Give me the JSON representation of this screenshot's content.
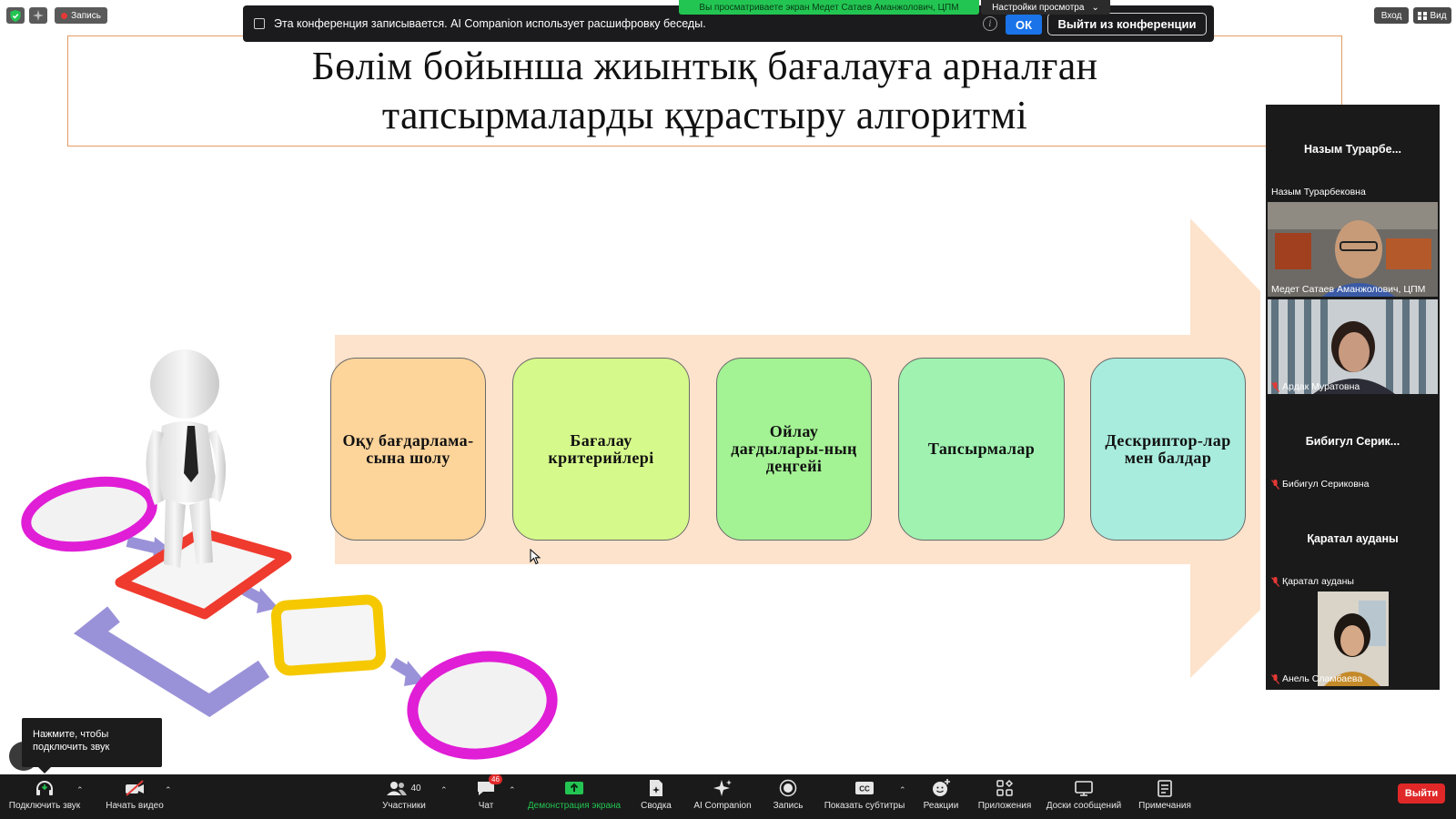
{
  "top_left": {
    "record_label": "Запись"
  },
  "top_right": {
    "login_label": "Вход",
    "view_label": "Вид"
  },
  "banner": {
    "text": "Эта конференция записывается. AI Companion использует расшифровку беседы.",
    "info": "i",
    "ok_label": "ОК",
    "leave_label": "Выйти из конференции",
    "viewing_text": "Вы просматриваете экран Медет Сатаев Аманжолович, ЦПМ",
    "view_settings": "Настройки просмотра"
  },
  "slide": {
    "title_line1": "Бөлім бойынша жиынтық бағалауға арналған",
    "title_line2": "тапсырмаларды құрастыру алгоритмі",
    "steps": [
      {
        "text": "Оқу бағдарлама-сына шолу",
        "color": "#fdd49a"
      },
      {
        "text": "Бағалау критерийлері",
        "color": "#d6f98b"
      },
      {
        "text": "Ойлау дағдылары-ның деңгейі",
        "color": "#a3f294"
      },
      {
        "text": "Тапсырмалар",
        "color": "#9ff2b0"
      },
      {
        "text": "Дескриптор-лар мен балдар",
        "color": "#a8ecdd"
      }
    ]
  },
  "participants": [
    {
      "center_name": "Назым  Турарбе...",
      "label": "Назым Турарбековна",
      "muted": false,
      "video": false
    },
    {
      "center_name": "",
      "label": "Медет Сатаев Аманжолович, ЦПМ",
      "muted": false,
      "video": true
    },
    {
      "center_name": "",
      "label": "Ардак Муратовна",
      "muted": true,
      "video": true
    },
    {
      "center_name": "Бибигул  Серик...",
      "label": "Бибигул Сериковна",
      "muted": true,
      "video": false
    },
    {
      "center_name": "Қаратал ауданы",
      "label": "Қаратал ауданы",
      "muted": true,
      "video": false
    },
    {
      "center_name": "",
      "label": "Анель Сламбаева",
      "muted": true,
      "video": true
    }
  ],
  "tooltip": {
    "text": "Нажмите, чтобы подключить звук"
  },
  "toolbar": {
    "audio": "Подключить звук",
    "video": "Начать видео",
    "participants": "Участники",
    "participants_count": "40",
    "chat": "Чат",
    "chat_badge": "46",
    "share": "Демонстрация экрана",
    "summary": "Сводка",
    "ai": "AI Companion",
    "record": "Запись",
    "captions": "Показать субтитры",
    "reactions": "Реакции",
    "apps": "Приложения",
    "whiteboards": "Доски сообщений",
    "notes": "Примечания",
    "end": "Выйти"
  },
  "colors": {
    "accent_green": "#23c552",
    "accent_blue": "#1a73e8",
    "end_red": "#e02828",
    "title_border": "#e39b62",
    "arrow": "#fde3cc"
  }
}
